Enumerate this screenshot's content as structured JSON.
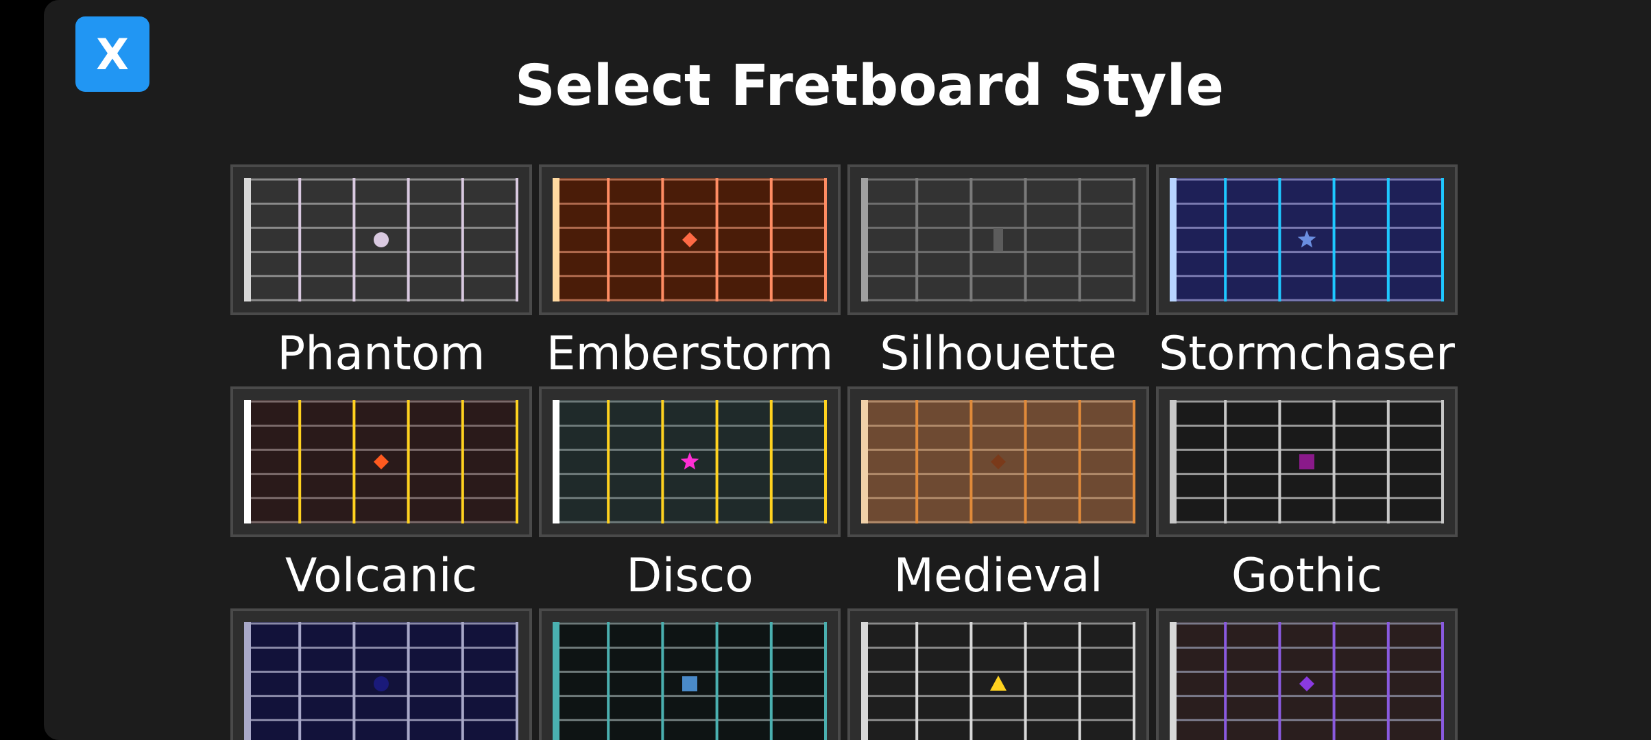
{
  "close_button": {
    "label": "X"
  },
  "title": "Select Fretboard Style",
  "styles": [
    {
      "name": "Phantom",
      "bg": "#333333",
      "fret": "#d9c9e0",
      "string": "#8a8a8a",
      "nut": "#d8d8d8",
      "marker": "circle",
      "marker_color": "#d9c9e0"
    },
    {
      "name": "Emberstorm",
      "bg": "#4a1c08",
      "fret": "#ff8c63",
      "string": "#b06a4e",
      "nut": "#ffd9a0",
      "marker": "diamond",
      "marker_color": "#ff6a45"
    },
    {
      "name": "Silhouette",
      "bg": "#333333",
      "fret": "#7a7a7a",
      "string": "#6e6e6e",
      "nut": "#a0a0a0",
      "marker": "bar",
      "marker_color": "#5c5c5c"
    },
    {
      "name": "Stormchaser",
      "bg": "#1e2057",
      "fret": "#1ec8ff",
      "string": "#7a7ab0",
      "nut": "#b8d4ff",
      "marker": "star",
      "marker_color": "#6a8ee0"
    },
    {
      "name": "Volcanic",
      "bg": "#2a1a1a",
      "fret": "#ffd21f",
      "string": "#7a6a6a",
      "nut": "#ffffff",
      "marker": "diamond",
      "marker_color": "#ff5a1f"
    },
    {
      "name": "Disco",
      "bg": "#1f2a2a",
      "fret": "#ffd21f",
      "string": "#6e7a7a",
      "nut": "#ffffff",
      "marker": "star",
      "marker_color": "#ff2fd5"
    },
    {
      "name": "Medieval",
      "bg": "#6e4a32",
      "fret": "#e08a3a",
      "string": "#b08a6a",
      "nut": "#f0d0a8",
      "marker": "diamond",
      "marker_color": "#7a3a1a"
    },
    {
      "name": "Gothic",
      "bg": "#1a1a1a",
      "fret": "#c8c8c8",
      "string": "#9a9a9a",
      "nut": "#c8c8c8",
      "marker": "square",
      "marker_color": "#8a1a8a"
    },
    {
      "name": "",
      "bg": "#12123a",
      "fret": "#a8a8c8",
      "string": "#8a8aa8",
      "nut": "#a8a8c8",
      "marker": "circle",
      "marker_color": "#1a1a7a"
    },
    {
      "name": "",
      "bg": "#0e1414",
      "fret": "#4ab0b0",
      "string": "#6e7a7a",
      "nut": "#4ab0b0",
      "marker": "square",
      "marker_color": "#4a8ac8"
    },
    {
      "name": "",
      "bg": "#1e1e1e",
      "fret": "#d8d8d8",
      "string": "#8a8a8a",
      "nut": "#d8d8d8",
      "marker": "triangle",
      "marker_color": "#ffd21f"
    },
    {
      "name": "",
      "bg": "#2a1e1e",
      "fret": "#8a5ae0",
      "string": "#7a7a8a",
      "nut": "#d8d8d8",
      "marker": "diamond",
      "marker_color": "#8a3ae0"
    }
  ]
}
